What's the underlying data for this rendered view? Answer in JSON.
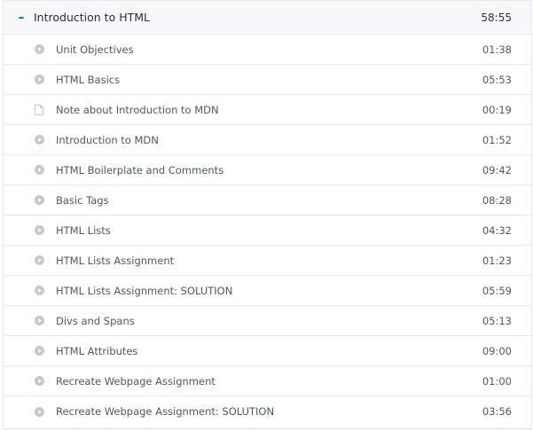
{
  "section": {
    "toggle_symbol": "–",
    "title": "Introduction to HTML",
    "duration": "58:55"
  },
  "icons": {
    "play": "play-circle-icon",
    "note": "document-icon",
    "icon_color": "#c5c8ce"
  },
  "lectures": [
    {
      "title": "Unit Objectives",
      "duration": "01:38",
      "icon": "play-circle-icon"
    },
    {
      "title": "HTML Basics",
      "duration": "05:53",
      "icon": "play-circle-icon"
    },
    {
      "title": "Note about Introduction to MDN",
      "duration": "00:19",
      "icon": "document-icon"
    },
    {
      "title": "Introduction to MDN",
      "duration": "01:52",
      "icon": "play-circle-icon"
    },
    {
      "title": "HTML Boilerplate and Comments",
      "duration": "09:42",
      "icon": "play-circle-icon"
    },
    {
      "title": "Basic Tags",
      "duration": "08:28",
      "icon": "play-circle-icon"
    },
    {
      "title": "HTML Lists",
      "duration": "04:32",
      "icon": "play-circle-icon"
    },
    {
      "title": "HTML Lists Assignment",
      "duration": "01:23",
      "icon": "play-circle-icon"
    },
    {
      "title": "HTML Lists Assignment: SOLUTION",
      "duration": "05:59",
      "icon": "play-circle-icon"
    },
    {
      "title": "Divs and Spans",
      "duration": "05:13",
      "icon": "play-circle-icon"
    },
    {
      "title": "HTML Attributes",
      "duration": "09:00",
      "icon": "play-circle-icon"
    },
    {
      "title": "Recreate Webpage Assignment",
      "duration": "01:00",
      "icon": "play-circle-icon"
    },
    {
      "title": "Recreate Webpage Assignment: SOLUTION",
      "duration": "03:56",
      "icon": "play-circle-icon"
    }
  ]
}
